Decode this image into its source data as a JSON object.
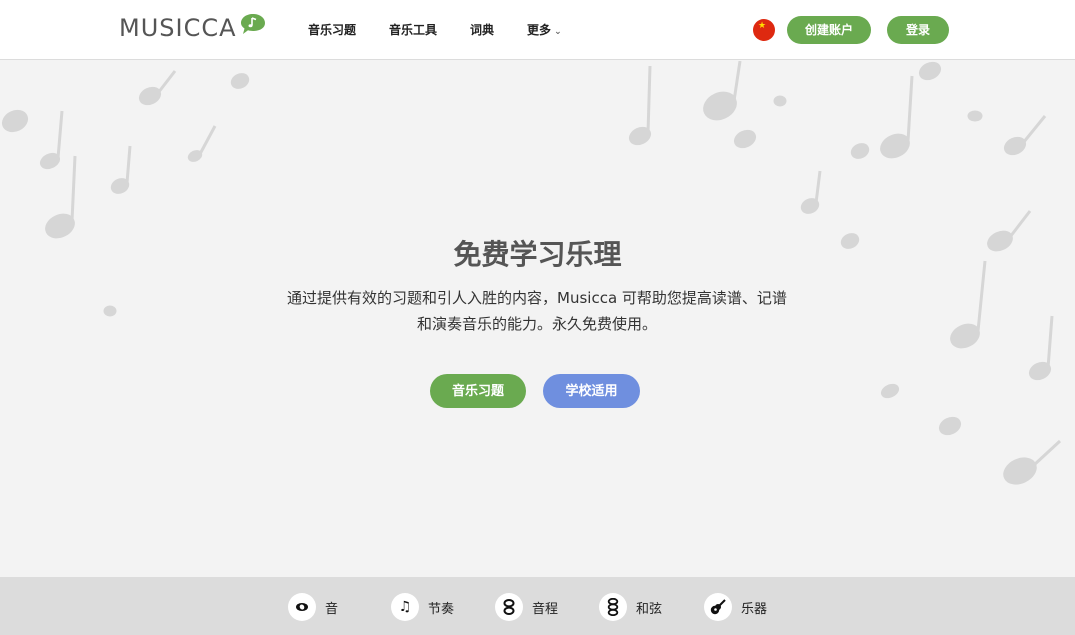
{
  "header": {
    "logo_text": "MUSICCA",
    "nav": [
      {
        "label": "音乐习题"
      },
      {
        "label": "音乐工具"
      },
      {
        "label": "词典"
      },
      {
        "label": "更多"
      }
    ],
    "flag_icon": "china-flag-icon",
    "signup_label": "创建账户",
    "login_label": "登录"
  },
  "hero": {
    "title": "免费学习乐理",
    "description": "通过提供有效的习题和引人入胜的内容，Musicca 可帮助您提高读谱、记谱和演奏音乐的能力。永久免费使用。",
    "cta_exercises": "音乐习题",
    "cta_schools": "学校适用"
  },
  "topics": [
    {
      "label": "音",
      "icon": "whole-note-icon"
    },
    {
      "label": "节奏",
      "icon": "beamed-notes-icon"
    },
    {
      "label": "音程",
      "icon": "interval-icon"
    },
    {
      "label": "和弦",
      "icon": "chord-icon"
    },
    {
      "label": "乐器",
      "icon": "guitar-icon"
    }
  ],
  "colors": {
    "green": "#6aaa50",
    "blue": "#6f8fdf",
    "hero_bg": "#f3f3f3",
    "topic_bar_bg": "#dcdcdc"
  }
}
